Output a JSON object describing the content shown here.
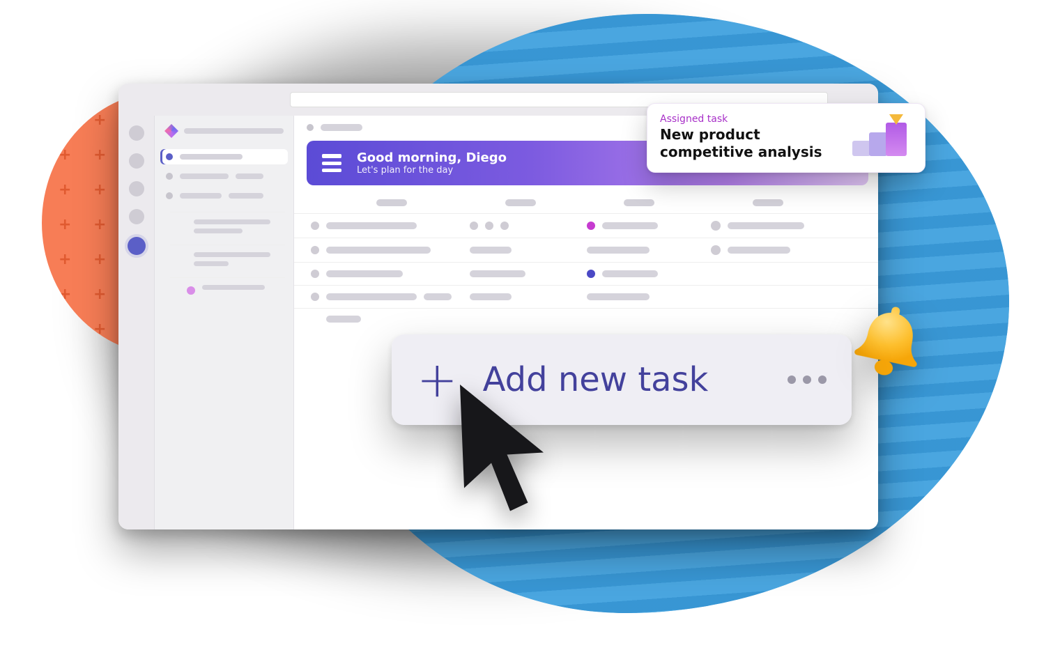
{
  "hero": {
    "title": "Good morning, Diego",
    "subtitle": "Let's plan for the day"
  },
  "toast": {
    "eyebrow": "Assigned task",
    "headline": "New product competitive analysis"
  },
  "add_task": {
    "label": "Add new task"
  }
}
